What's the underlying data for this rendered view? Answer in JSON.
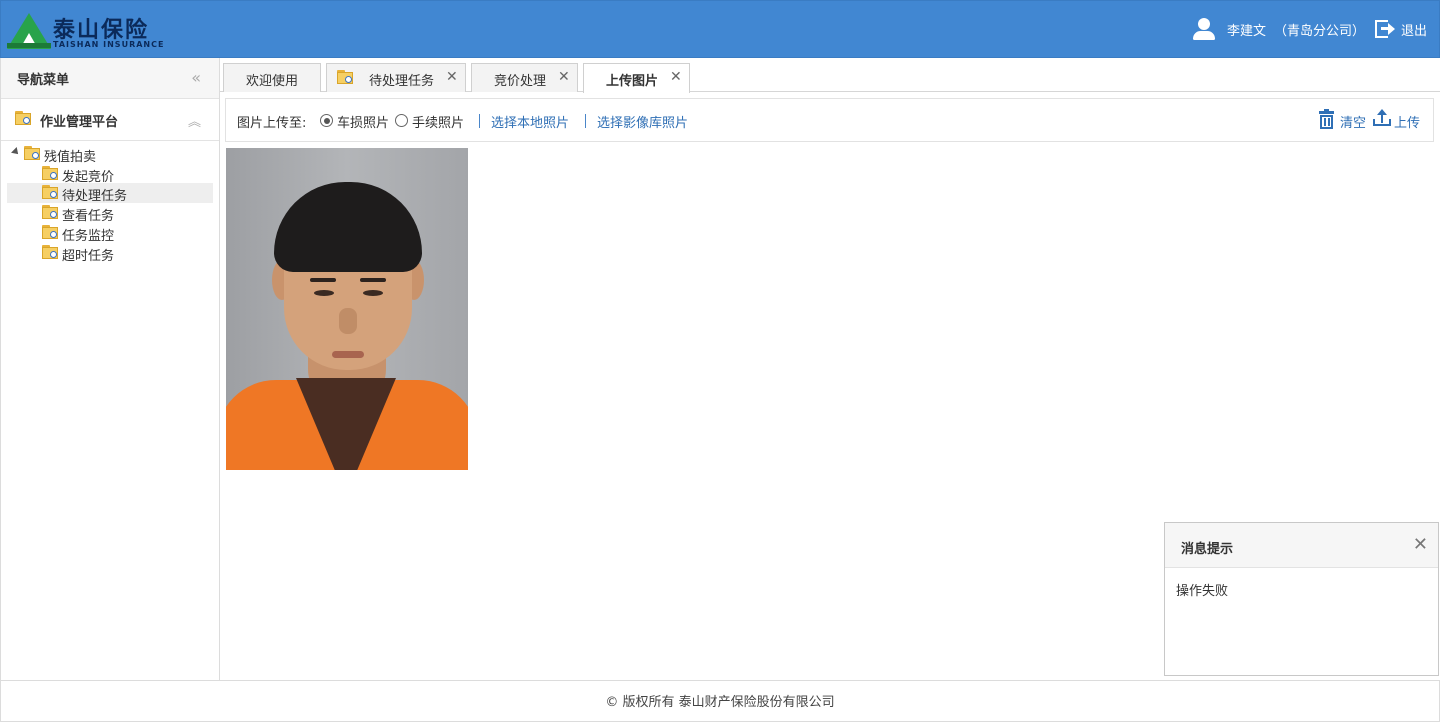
{
  "header": {
    "brand_cn": "泰山保险",
    "brand_en": "TAISHAN INSURANCE",
    "user_name": "李建文",
    "user_org": "（青岛分公司）",
    "logout_label": "退出"
  },
  "sidebar": {
    "nav_title": "导航菜单",
    "collapse_icon": "«",
    "panel_title": "作业管理平台",
    "panel_toggle_icon": "︽",
    "tree_root": "残值拍卖",
    "tree_items": [
      {
        "label": "发起竞价"
      },
      {
        "label": "待处理任务",
        "selected": true
      },
      {
        "label": "查看任务"
      },
      {
        "label": "任务监控"
      },
      {
        "label": "超时任务"
      }
    ]
  },
  "tabs": [
    {
      "label": "欢迎使用",
      "closable": false
    },
    {
      "label": "待处理任务",
      "closable": true,
      "icon": "folder-search-icon"
    },
    {
      "label": "竞价处理",
      "closable": true
    },
    {
      "label": "上传图片",
      "closable": true,
      "active": true
    }
  ],
  "tab_close_glyph": "✕",
  "toolbar": {
    "upload_to_label": "图片上传至:",
    "radio_damage": "车损照片",
    "radio_procedure": "手续照片",
    "radio_selected": "车损照片",
    "select_local": "选择本地照片",
    "select_library": "选择影像库照片",
    "clear_label": "清空",
    "upload_label": "上传"
  },
  "message": {
    "title": "消息提示",
    "close_glyph": "✕",
    "body": "操作失败"
  },
  "footer": {
    "copyright": "© 版权所有 泰山财产保险股份有限公司"
  },
  "colors": {
    "header_bg": "#4187d2",
    "link": "#2f6fb5",
    "brand_green": "#28a34b"
  }
}
